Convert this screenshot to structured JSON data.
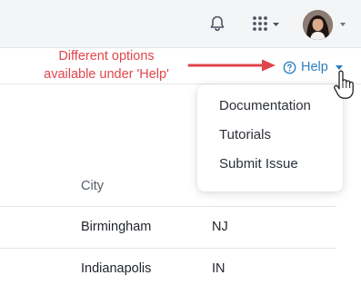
{
  "header": {
    "icons": [
      "bell-icon",
      "apps-grid-icon",
      "user-avatar"
    ]
  },
  "annotation": {
    "line1": "Different options",
    "line2": "available under 'Help'",
    "color": "#e0454b"
  },
  "help_menu": {
    "label": "Help",
    "items": [
      "Documentation",
      "Tutorials",
      "Submit Issue"
    ],
    "accent": "#2d7fc1"
  },
  "table": {
    "headers": [
      "City"
    ],
    "rows": [
      [
        "Birmingham",
        "NJ"
      ],
      [
        "Indianapolis",
        "IN"
      ]
    ]
  }
}
